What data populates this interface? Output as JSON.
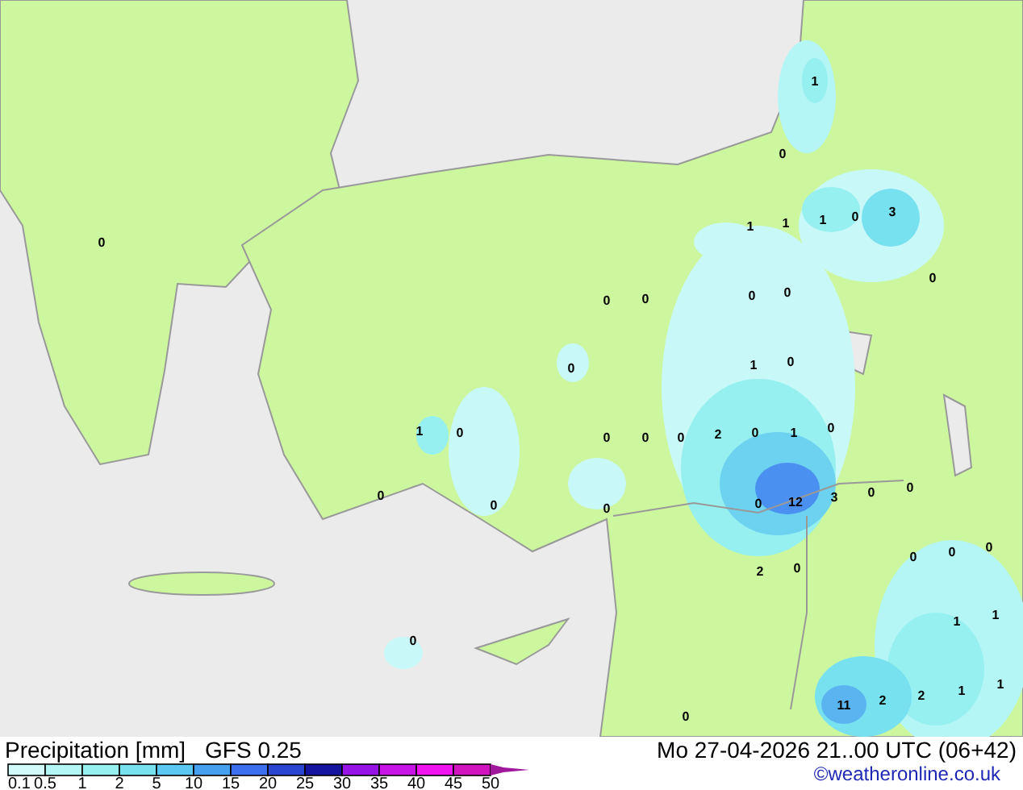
{
  "map": {
    "values": [
      "1",
      "0",
      "0",
      "1",
      "1",
      "1",
      "0",
      "3",
      "0",
      "0",
      "0",
      "0",
      "0",
      "0",
      "1",
      "0",
      "1",
      "0",
      "0",
      "0",
      "0",
      "2",
      "0",
      "1",
      "0",
      "0",
      "0",
      "0",
      "0",
      "12",
      "3",
      "0",
      "0",
      "2",
      "0",
      "0",
      "0",
      "0",
      "1",
      "1",
      "1",
      "1",
      "2",
      "2",
      "11",
      "0",
      "0"
    ]
  },
  "legend": {
    "title": "Precipitation [mm]",
    "model": "GFS 0.25",
    "scale": [
      {
        "label": "0.1",
        "color": "#d2fafa"
      },
      {
        "label": "0.5",
        "color": "#b4f5f5"
      },
      {
        "label": "1",
        "color": "#96f0f0"
      },
      {
        "label": "2",
        "color": "#78e1f0"
      },
      {
        "label": "5",
        "color": "#5ac8f0"
      },
      {
        "label": "10",
        "color": "#46a0f0"
      },
      {
        "label": "15",
        "color": "#3c6ef0"
      },
      {
        "label": "20",
        "color": "#2846d2"
      },
      {
        "label": "25",
        "color": "#1414a0"
      },
      {
        "label": "30",
        "color": "#9614e6"
      },
      {
        "label": "35",
        "color": "#c814e6"
      },
      {
        "label": "40",
        "color": "#f014f0"
      },
      {
        "label": "45",
        "color": "#d214be"
      },
      {
        "label": "50",
        "color": "#a0189c"
      }
    ]
  },
  "valid_time": "Mo 27-04-2026 21..00 UTC (06+42)",
  "credit": "©weatheronline.co.uk"
}
